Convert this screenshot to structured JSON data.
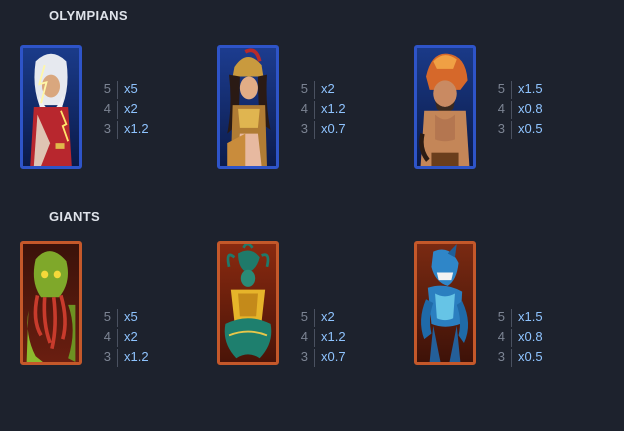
{
  "sections": [
    {
      "title": "OLYMPIANS",
      "frame_color": "#2e54c8",
      "symbols": [
        {
          "icon": "zeus-icon",
          "payouts": [
            {
              "count": "5",
              "multiplier": "x5"
            },
            {
              "count": "4",
              "multiplier": "x2"
            },
            {
              "count": "3",
              "multiplier": "x1.2"
            }
          ]
        },
        {
          "icon": "athena-icon",
          "payouts": [
            {
              "count": "5",
              "multiplier": "x2"
            },
            {
              "count": "4",
              "multiplier": "x1.2"
            },
            {
              "count": "3",
              "multiplier": "x0.7"
            }
          ]
        },
        {
          "icon": "hercules-icon",
          "payouts": [
            {
              "count": "5",
              "multiplier": "x1.5"
            },
            {
              "count": "4",
              "multiplier": "x0.8"
            },
            {
              "count": "3",
              "multiplier": "x0.5"
            }
          ]
        }
      ]
    },
    {
      "title": "GIANTS",
      "frame_color": "#c4582a",
      "symbols": [
        {
          "icon": "kraken-giant-icon",
          "payouts": [
            {
              "count": "5",
              "multiplier": "x5"
            },
            {
              "count": "4",
              "multiplier": "x2"
            },
            {
              "count": "3",
              "multiplier": "x1.2"
            }
          ]
        },
        {
          "icon": "gorgon-giant-icon",
          "payouts": [
            {
              "count": "5",
              "multiplier": "x2"
            },
            {
              "count": "4",
              "multiplier": "x1.2"
            },
            {
              "count": "3",
              "multiplier": "x0.7"
            }
          ]
        },
        {
          "icon": "shark-giant-icon",
          "payouts": [
            {
              "count": "5",
              "multiplier": "x1.5"
            },
            {
              "count": "4",
              "multiplier": "x0.8"
            },
            {
              "count": "3",
              "multiplier": "x0.5"
            }
          ]
        }
      ]
    }
  ]
}
